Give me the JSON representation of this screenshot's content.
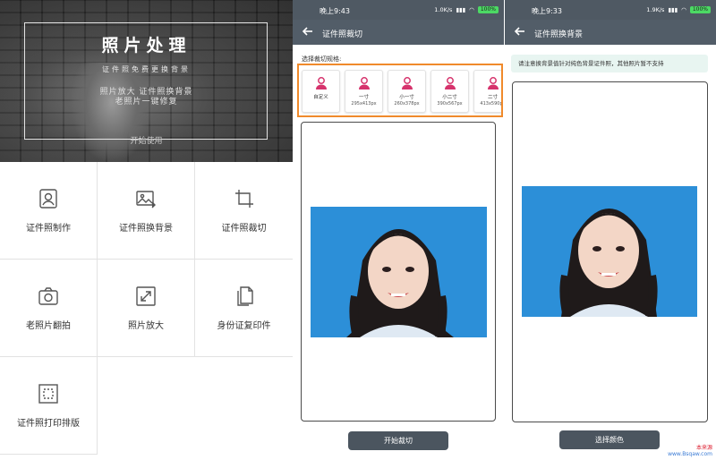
{
  "panel1": {
    "hero": {
      "title": "照片处理",
      "subtitle": "证件照免费更换背景",
      "line1": "照片放大 证件照换背景",
      "line2": "老照片一键修复",
      "bottom": "开始使用"
    },
    "grid": [
      {
        "label": "证件照制作",
        "icon": "id-photo-icon"
      },
      {
        "label": "证件照换背景",
        "icon": "image-change-icon"
      },
      {
        "label": "证件照裁切",
        "icon": "crop-icon"
      },
      {
        "label": "老照片翻拍",
        "icon": "camera-icon"
      },
      {
        "label": "照片放大",
        "icon": "enlarge-icon"
      },
      {
        "label": "身份证复印件",
        "icon": "document-copy-icon"
      },
      {
        "label": "证件照打印排版",
        "icon": "print-layout-icon"
      }
    ]
  },
  "panel2": {
    "status": {
      "time": "晚上9:43",
      "speed": "1.0K/s",
      "battery": "100%"
    },
    "title": "证件照裁切",
    "spec_label": "选择裁切规格:",
    "specs": [
      {
        "name": "自定义",
        "size": ""
      },
      {
        "name": "一寸",
        "size": "295x413px"
      },
      {
        "name": "小一寸",
        "size": "260x378px"
      },
      {
        "name": "小二寸",
        "size": "390x567px"
      },
      {
        "name": "二寸",
        "size": "413x590px"
      }
    ],
    "button": "开始裁切"
  },
  "panel3": {
    "status": {
      "time": "晚上9:33",
      "speed": "1.9K/s",
      "battery": "100%"
    },
    "title": "证件照换背景",
    "notice": "请注意换背景值针对纯色背景证件照，其他照片暂不支持",
    "button": "选择颜色"
  },
  "watermark": {
    "line1": "本来源",
    "line2": "www.Bsqaw.com"
  },
  "colors": {
    "accent_orange": "#f08a2b",
    "pink": "#d6336c",
    "appbar": "#525d68",
    "status": "#4f5963",
    "photo_bg": "#2c8fd8"
  }
}
